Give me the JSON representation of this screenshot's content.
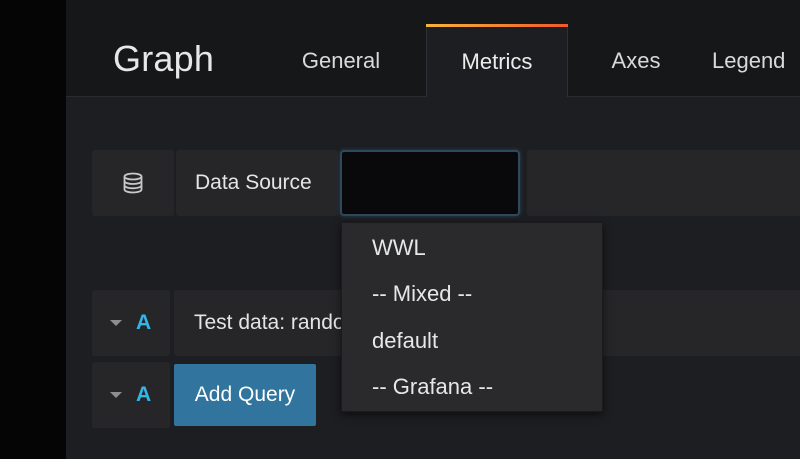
{
  "header": {
    "panel_title": "Graph",
    "tabs": [
      {
        "label": "General"
      },
      {
        "label": "Metrics"
      },
      {
        "label": "Axes"
      },
      {
        "label": "Legend"
      }
    ]
  },
  "data_source": {
    "icon": "database-icon",
    "label": "Data Source",
    "value": "",
    "options": [
      "WWL",
      "-- Mixed --",
      "default",
      "-- Grafana --"
    ]
  },
  "queries": [
    {
      "ref": "A",
      "text": "Test data: random walk"
    }
  ],
  "add_query": {
    "ref": "A",
    "label": "Add Query"
  },
  "colors": {
    "accent": "#33b5e5",
    "button": "#31759e",
    "tab_gradient_start": "#f6b43b",
    "tab_gradient_end": "#f05a28"
  }
}
